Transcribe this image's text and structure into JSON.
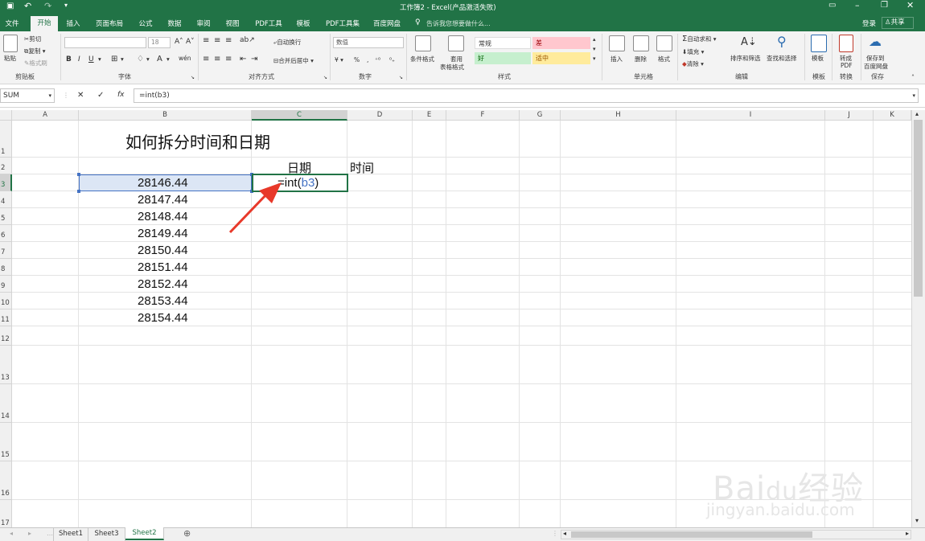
{
  "window": {
    "title": "工作簿2 - Excel(产品激活失败)"
  },
  "ribbon": {
    "tabs": [
      "文件",
      "开始",
      "插入",
      "页面布局",
      "公式",
      "数据",
      "审阅",
      "视图",
      "PDF工具",
      "模板",
      "PDF工具集",
      "百度网盘"
    ],
    "active_tab": "开始",
    "tell_me": "告诉我您想要做什么...",
    "login": "登录",
    "share": "共享",
    "clipboard": {
      "paste": "粘贴",
      "cut": "剪切",
      "copy": "复制",
      "format_painter": "格式刷",
      "label": "剪贴板"
    },
    "font": {
      "label": "字体",
      "size": "18"
    },
    "alignment": {
      "wrap": "自动换行",
      "merge": "合并后居中",
      "label": "对齐方式"
    },
    "number": {
      "format": "数值",
      "label": "数字",
      "percent": "%"
    },
    "styles": {
      "conditional": "条件格式",
      "table": "套用",
      "table2": "表格格式",
      "normal": "常规",
      "bad": "差",
      "good": "好",
      "neutral": "适中",
      "label": "样式"
    },
    "cells": {
      "insert": "插入",
      "delete": "删除",
      "format": "格式",
      "label": "单元格"
    },
    "editing": {
      "autosum": "自动求和",
      "fill": "填充",
      "clear": "清除",
      "sort": "排序和筛选",
      "find": "查找和选择",
      "label": "编辑"
    },
    "template": {
      "btn": "模板",
      "label": "模板"
    },
    "convert": {
      "btn": "转成",
      "btn2": "PDF",
      "label": "转换"
    },
    "save": {
      "btn": "保存到",
      "btn2": "百度网盘",
      "label": "保存"
    }
  },
  "formula_bar": {
    "name_box": "SUM",
    "formula": "=int(b3)",
    "fx": "fx"
  },
  "sheet": {
    "columns": [
      "A",
      "B",
      "C",
      "D",
      "E",
      "F",
      "G",
      "H",
      "I",
      "J",
      "K"
    ],
    "rows": [
      "1",
      "2",
      "3",
      "4",
      "5",
      "6",
      "7",
      "8",
      "9",
      "10",
      "11",
      "12",
      "13",
      "14",
      "15",
      "16",
      "17"
    ],
    "title": "如何拆分时间和日期",
    "header_date": "日期",
    "header_time": "时间",
    "values": [
      "28146.44",
      "28147.44",
      "28148.44",
      "28149.44",
      "28150.44",
      "28151.44",
      "28152.44",
      "28153.44",
      "28154.44"
    ],
    "editing_cell": {
      "prefix": "=int(",
      "ref": "b3",
      "suffix": ")"
    }
  },
  "sheet_tabs": [
    "Sheet1",
    "Sheet3",
    "Sheet2"
  ],
  "active_sheet": "Sheet2",
  "colors": {
    "excel_green": "#217346",
    "ref_blue": "#4472c4",
    "arrow_red": "#e8392a"
  }
}
